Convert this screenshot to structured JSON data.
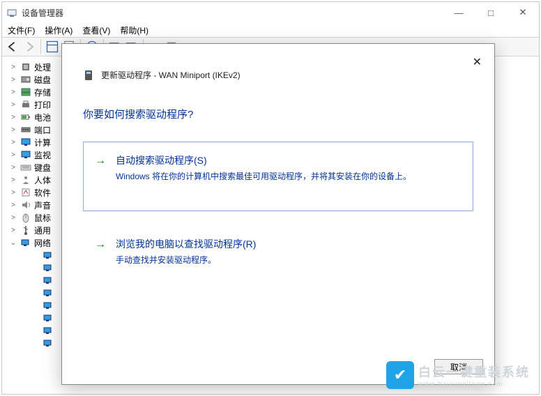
{
  "window": {
    "title": "设备管理器",
    "min": "—",
    "max": "□",
    "close": "✕"
  },
  "menu": {
    "file": "文件(F)",
    "action": "操作(A)",
    "view": "查看(V)",
    "help": "帮助(H)"
  },
  "tree": {
    "items": [
      {
        "label": "处理",
        "icon": "chip"
      },
      {
        "label": "磁盘",
        "icon": "disk"
      },
      {
        "label": "存储",
        "icon": "storage"
      },
      {
        "label": "打印",
        "icon": "printer"
      },
      {
        "label": "电池",
        "icon": "battery"
      },
      {
        "label": "端口",
        "icon": "port"
      },
      {
        "label": "计算",
        "icon": "monitor"
      },
      {
        "label": "监视",
        "icon": "monitor"
      },
      {
        "label": "键盘",
        "icon": "keyboard"
      },
      {
        "label": "人体",
        "icon": "hid"
      },
      {
        "label": "软件",
        "icon": "software"
      },
      {
        "label": "声音",
        "icon": "sound"
      },
      {
        "label": "鼠标",
        "icon": "mouse"
      },
      {
        "label": "通用",
        "icon": "usb"
      }
    ],
    "expanded": {
      "label": "网络",
      "icon": "network",
      "children_count": 8
    }
  },
  "dialog": {
    "title": "更新驱动程序 - WAN Miniport (IKEv2)",
    "question": "你要如何搜索驱动程序?",
    "opt1": {
      "title": "自动搜索驱动程序(S)",
      "desc": "Windows 将在你的计算机中搜索最佳可用驱动程序，并将其安装在你的设备上。"
    },
    "opt2": {
      "title": "浏览我的电脑以查找驱动程序(R)",
      "desc": "手动查找并安装驱动程序。"
    },
    "cancel": "取消"
  },
  "watermark": {
    "brand": "白云一键重装系统",
    "url": "www.baiyunxitong.com"
  }
}
